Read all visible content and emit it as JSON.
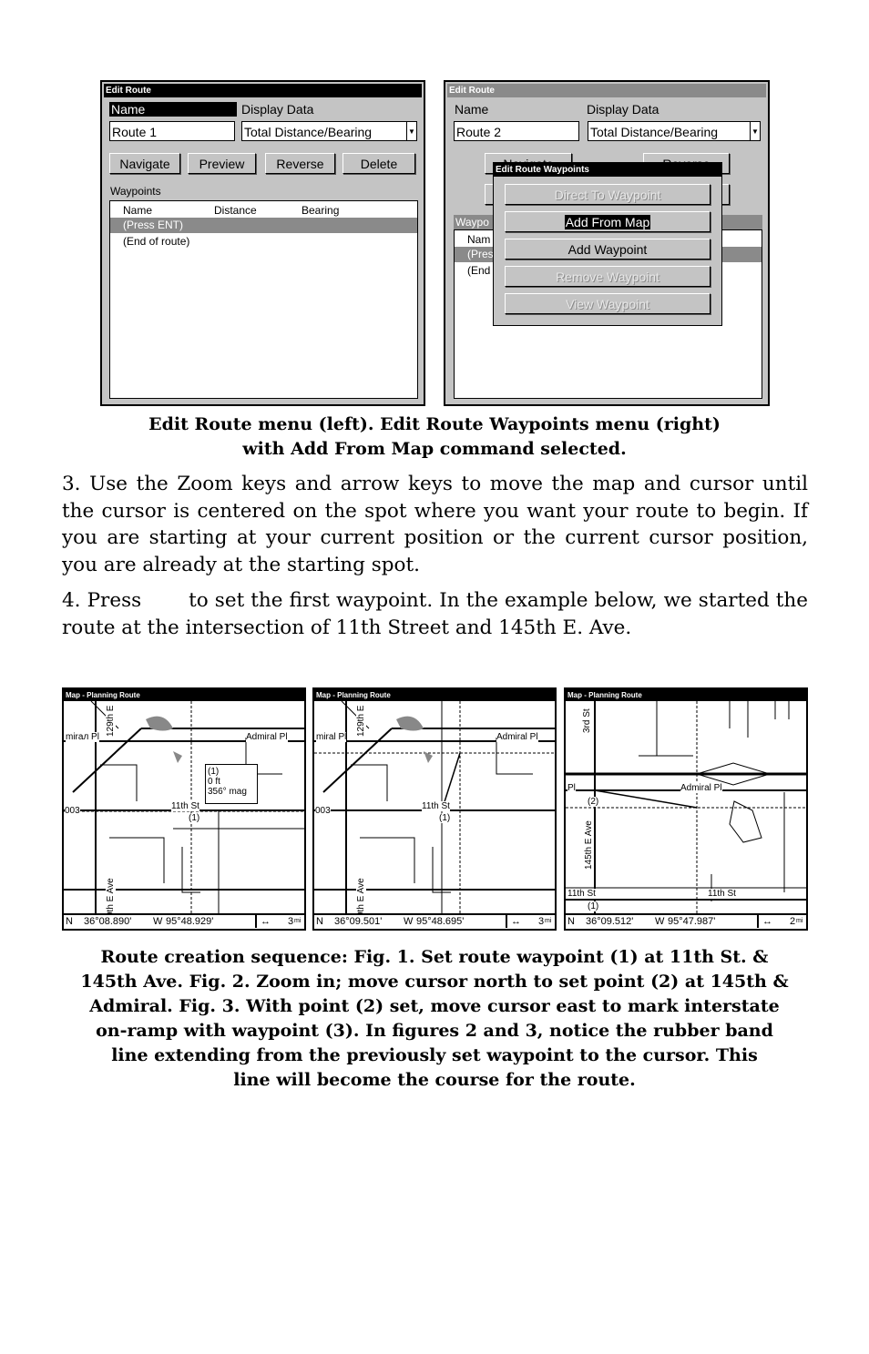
{
  "left_screen": {
    "title": "Edit Route",
    "name_label": "Name",
    "display_label": "Display Data",
    "name_value": "Route 1",
    "display_value": "Total Distance/Bearing",
    "buttons": [
      "Navigate",
      "Preview",
      "Reverse",
      "Delete"
    ],
    "waypoints_label": "Waypoints",
    "columns": [
      "Name",
      "Distance",
      "Bearing"
    ],
    "rows": [
      "(Press ENT)",
      "(End of route)"
    ]
  },
  "right_screen": {
    "title": "Edit Route",
    "name_label": "Name",
    "display_label": "Display Data",
    "name_value": "Route 2",
    "display_value": "Total Distance/Bearing",
    "buttons_partial": [
      "Navigate",
      "Reverse"
    ],
    "waypoints_partial": "Waypo",
    "col_partial": "Nam",
    "rows_partial": [
      "(Pres",
      "(End"
    ],
    "popup": {
      "title": "Edit Route Waypoints",
      "items": [
        {
          "label": "Direct To Waypoint",
          "state": "disabled"
        },
        {
          "label": "Add From Map",
          "state": "selected"
        },
        {
          "label": "Add Waypoint",
          "state": "enabled"
        },
        {
          "label": "Remove Waypoint",
          "state": "disabled"
        },
        {
          "label": "View Waypoint",
          "state": "disabled"
        }
      ]
    }
  },
  "caption1": [
    "Edit Route menu (left). Edit Route Waypoints menu (right)",
    "with Add From Map command selected."
  ],
  "step3": "3. Use the Zoom keys and arrow keys to move the map and cursor until the cursor is centered on the spot where you want your route to begin. If you are starting at your current position or the current cursor position, you are already at the starting spot.",
  "step4_a": "4. Press",
  "step4_b": "to set the first waypoint. In the example below, we started the route at the intersection of 11th Street and 145th E. Ave.",
  "maps": [
    {
      "title": "Map - Planning Route",
      "lat": "N",
      "lat_val": "36°08.890'",
      "lon": "W",
      "lon_val": "95°48.929'",
      "scale": "3",
      "unit": "mi",
      "labels": [
        "129th E",
        "mirал Pl",
        "Admiral Pl",
        "11th St",
        "(1)",
        "003",
        "9th E Ave"
      ],
      "popup": [
        "(1)",
        "0 ft",
        "356° mag"
      ]
    },
    {
      "title": "Map - Planning Route",
      "lat": "N",
      "lat_val": "36°09.501'",
      "lon": "W",
      "lon_val": "95°48.695'",
      "scale": "3",
      "unit": "mi",
      "labels": [
        "129th E",
        "miral Pl",
        "Admiral Pl",
        "11th St",
        "(1)",
        "003",
        "9th E Ave"
      ]
    },
    {
      "title": "Map - Planning Route",
      "lat": "N",
      "lat_val": "36°09.512'",
      "lon": "W",
      "lon_val": "95°47.987'",
      "scale": "2",
      "unit": "mi",
      "labels": [
        "3rd St",
        "Pl",
        "Admiral Pl",
        "(2)",
        "145th E Ave",
        "11th St",
        "11th St",
        "(1)"
      ]
    }
  ],
  "caption2": [
    "Route creation sequence: Fig. 1. Set route waypoint (1) at 11th St. &",
    "145th Ave. Fig. 2. Zoom in; move cursor north to set point (2) at 145th &",
    "Admiral. Fig. 3. With point (2) set, move cursor east to mark interstate",
    "on-ramp with waypoint (3). In figures 2 and 3, notice the rubber band",
    "line extending from the previously set waypoint to the cursor. This",
    "line will become the course for the route."
  ]
}
